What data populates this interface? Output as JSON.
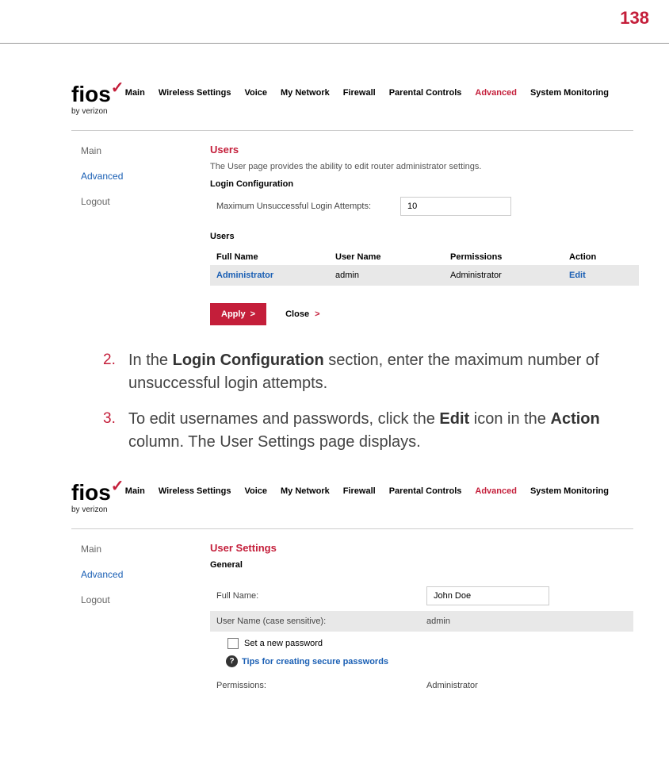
{
  "page_number": "138",
  "logo": {
    "brand": "fios",
    "byline": "by verizon"
  },
  "topnav": {
    "items": [
      "Main",
      "Wireless Settings",
      "Voice",
      "My Network",
      "Firewall",
      "Parental Controls",
      "Advanced",
      "System Monitoring"
    ],
    "active_index": 6
  },
  "sidenav": {
    "items": [
      "Main",
      "Advanced",
      "Logout"
    ],
    "active_index": 1
  },
  "users_panel": {
    "title": "Users",
    "description": "The User page provides the ability to edit router administrator settings.",
    "login_config_label": "Login Configuration",
    "max_attempts_label": "Maximum Unsuccessful Login Attempts:",
    "max_attempts_value": "10",
    "users_label": "Users",
    "columns": {
      "fullname": "Full Name",
      "username": "User Name",
      "permissions": "Permissions",
      "action": "Action"
    },
    "rows": [
      {
        "fullname": "Administrator",
        "username": "admin",
        "permissions": "Administrator",
        "action": "Edit"
      }
    ],
    "apply_btn": "Apply",
    "close_btn": "Close"
  },
  "instructions": [
    {
      "num": "2.",
      "text_pre": "In the ",
      "bold1": "Login Configuration",
      "text_post": " section, enter the maximum number of unsuccessful login attempts."
    },
    {
      "num": "3.",
      "text_pre": "To edit usernames and passwords, click the ",
      "bold1": "Edit",
      "text_mid": " icon in the ",
      "bold2": "Action",
      "text_post": " column. The User Settings page displays."
    }
  ],
  "settings_panel": {
    "title": "User Settings",
    "general_label": "General",
    "fullname_label": "Full Name:",
    "fullname_value": "John Doe",
    "username_label": "User Name (case sensitive):",
    "username_value": "admin",
    "set_password_label": "Set a new password",
    "tips_label": "Tips for creating secure passwords",
    "permissions_label": "Permissions:",
    "permissions_value": "Administrator"
  }
}
